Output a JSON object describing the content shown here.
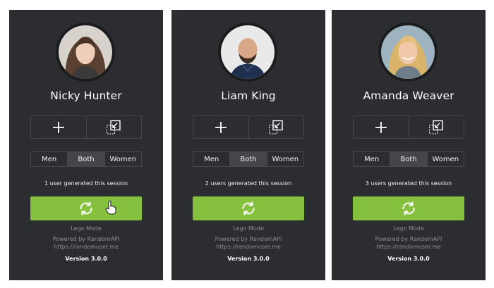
{
  "cards": [
    {
      "name": "Nicky Hunter",
      "avatar_icon": "avatar-photo-woman",
      "actions": {
        "add_icon": "plus-icon",
        "export_icon": "export-icon"
      },
      "gender_options": [
        "Men",
        "Both",
        "Women"
      ],
      "gender_selected": "Both",
      "session_text": "1 user generated this session",
      "generate_icon": "refresh-icon",
      "footer": {
        "mode": "Lego Mode",
        "powered": "Powered by RandomAPI",
        "url": "https://randomuser.me",
        "version": "Version 3.0.0"
      }
    },
    {
      "name": "Liam King",
      "avatar_icon": "avatar-photo-man",
      "actions": {
        "add_icon": "plus-icon",
        "export_icon": "export-icon"
      },
      "gender_options": [
        "Men",
        "Both",
        "Women"
      ],
      "gender_selected": "Both",
      "session_text": "2 users generated this session",
      "generate_icon": "refresh-icon",
      "footer": {
        "mode": "Lego Mode",
        "powered": "Powered by RandomAPI",
        "url": "https://randomuser.me",
        "version": "Version 3.0.0"
      }
    },
    {
      "name": "Amanda Weaver",
      "avatar_icon": "avatar-photo-woman",
      "actions": {
        "add_icon": "plus-icon",
        "export_icon": "export-icon"
      },
      "gender_options": [
        "Men",
        "Both",
        "Women"
      ],
      "gender_selected": "Both",
      "session_text": "3 users generated this session",
      "generate_icon": "refresh-icon",
      "footer": {
        "mode": "Lego Mode",
        "powered": "Powered by RandomAPI",
        "url": "https://randomuser.me",
        "version": "Version 3.0.0"
      }
    }
  ],
  "colors": {
    "card_background": "#2c2d30",
    "accent_green": "#85c13f",
    "border": "#46474b",
    "active_toggle": "#45464a",
    "muted_text": "#8d8e91"
  }
}
